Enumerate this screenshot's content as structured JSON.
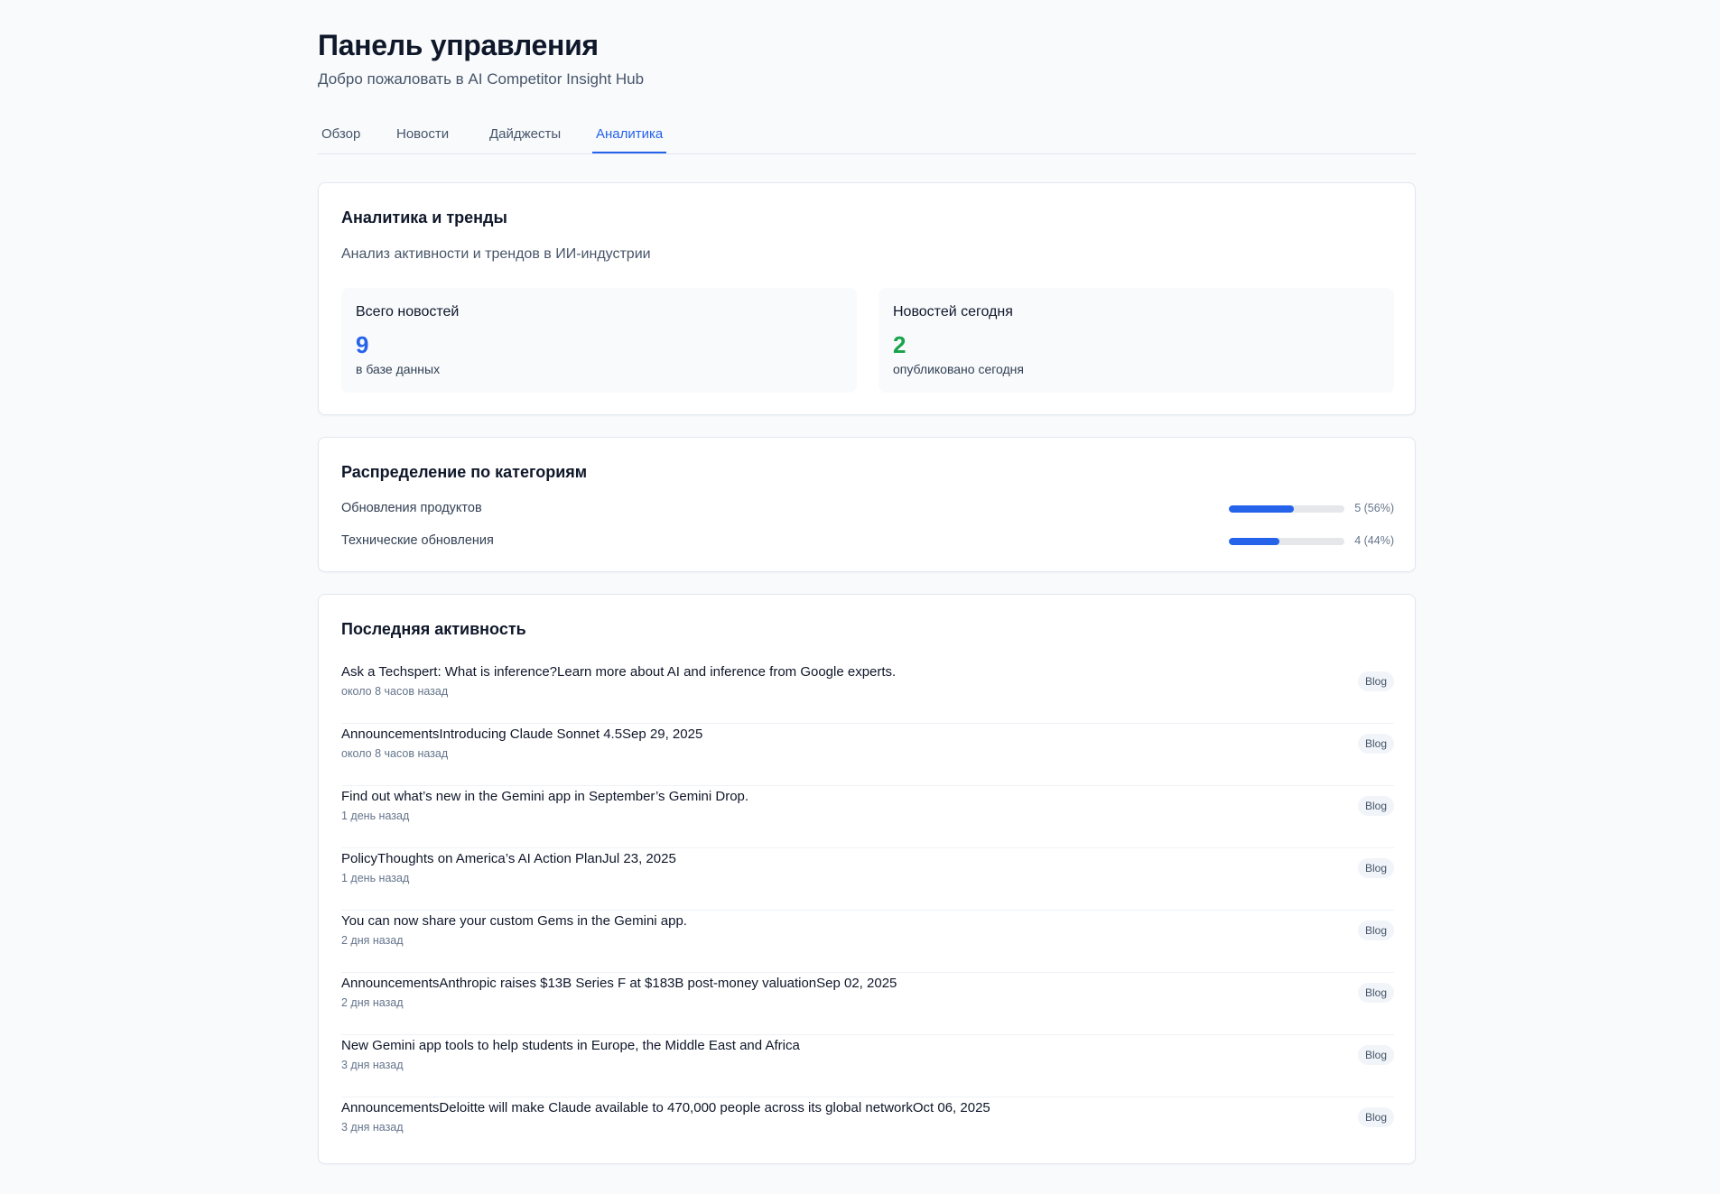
{
  "header": {
    "title": "Панель управления",
    "subtitle": "Добро пожаловать в AI Competitor Insight Hub"
  },
  "tabs": [
    {
      "label": "Обзор",
      "active": false
    },
    {
      "label": "Новости",
      "active": false
    },
    {
      "label": "Дайджесты",
      "active": false
    },
    {
      "label": "Аналитика",
      "active": true
    }
  ],
  "analytics": {
    "title": "Аналитика и тренды",
    "description": "Анализ активности и трендов в ИИ-индустрии",
    "stats": [
      {
        "label": "Всего новостей",
        "value": "9",
        "note": "в базе данных",
        "color": "#2563eb"
      },
      {
        "label": "Новостей сегодня",
        "value": "2",
        "note": "опубликовано сегодня",
        "color": "#16a34a"
      }
    ]
  },
  "categories": {
    "title": "Распределение по категориям",
    "items": [
      {
        "label": "Обновления продуктов",
        "count_text": "5 (56%)",
        "fraction": 0.56
      },
      {
        "label": "Технические обновления",
        "count_text": "4 (44%)",
        "fraction": 0.44
      }
    ]
  },
  "activity": {
    "title": "Последняя активность",
    "items": [
      {
        "title": "Ask a Techspert: What is inference?Learn more about AI and inference from Google experts.",
        "time": "около 8 часов назад",
        "badge": "Blog"
      },
      {
        "title": "AnnouncementsIntroducing Claude Sonnet 4.5Sep 29, 2025",
        "time": "около 8 часов назад",
        "badge": "Blog"
      },
      {
        "title": "Find out what’s new in the Gemini app in September’s Gemini Drop.",
        "time": "1 день назад",
        "badge": "Blog"
      },
      {
        "title": "PolicyThoughts on America’s AI Action PlanJul 23, 2025",
        "time": "1 день назад",
        "badge": "Blog"
      },
      {
        "title": "You can now share your custom Gems in the Gemini app.",
        "time": "2 дня назад",
        "badge": "Blog"
      },
      {
        "title": "AnnouncementsAnthropic raises $13B Series F at $183B post-money valuationSep 02, 2025",
        "time": "2 дня назад",
        "badge": "Blog"
      },
      {
        "title": "New Gemini app tools to help students in Europe, the Middle East and Africa",
        "time": "3 дня назад",
        "badge": "Blog"
      },
      {
        "title": "AnnouncementsDeloitte will make Claude available to 470,000 people across its global networkOct 06, 2025",
        "time": "3 дня назад",
        "badge": "Blog"
      }
    ]
  }
}
